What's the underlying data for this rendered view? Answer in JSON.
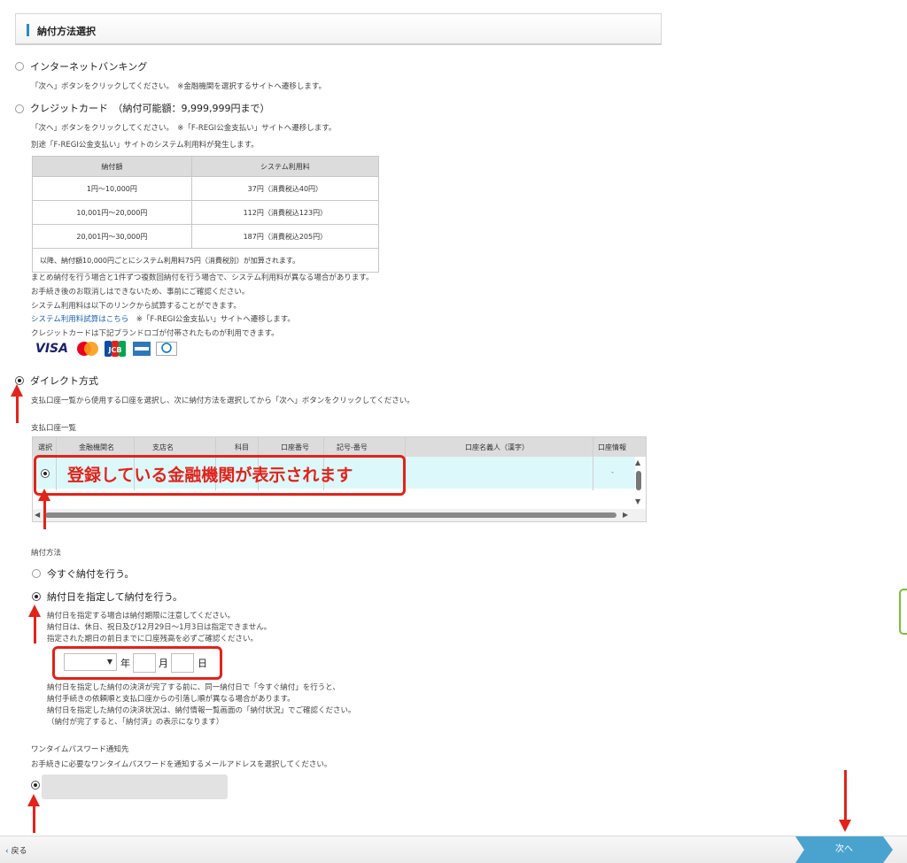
{
  "section": {
    "title": "納付方法選択"
  },
  "methods": {
    "internet_banking": {
      "label": "インターネットバンキング",
      "note": "「次へ」ボタンをクリックしてください。　※金融機関を選択するサイトへ遷移します。"
    },
    "credit_card": {
      "label": "クレジットカード　（納付可能額：9,999,999円まで）",
      "note1": "「次へ」ボタンをクリックしてください。　※「F-REGI公金支払い」サイトへ遷移します。",
      "note2": "別途「F-REGI公金支払い」サイトのシステム利用料が発生します。",
      "fee_table": {
        "headers": [
          "納付額",
          "システム利用料"
        ],
        "rows": [
          [
            "1円～10,000円",
            "37円（消費税込40円）"
          ],
          [
            "10,001円～20,000円",
            "112円（消費税込123円）"
          ],
          [
            "20,001円～30,000円",
            "187円（消費税込205円）"
          ]
        ],
        "footer": "以降、納付額10,000円ごとにシステム利用料75円（消費税別）が加算されます。"
      },
      "after1": "まとめ納付を行う場合と1件ずつ複数回納付を行う場合で、システム利用料が異なる場合があります。",
      "after2": "お手続き後のお取消しはできないため、事前にご確認ください。",
      "after3": "システム利用料は以下のリンクから試算することができます。",
      "link": "システム利用料試算はこちら",
      "link_note": "　※「F-REGI公金支払い」サイトへ遷移します。",
      "brand_note": "クレジットカードは下記ブランドロゴが付帯されたものが利用できます。",
      "brands": [
        "VISA",
        "mastercard",
        "JCB",
        "AMERICAN EXPRESS",
        "Diners Club"
      ]
    },
    "direct": {
      "label": "ダイレクト方式",
      "note": "支払口座一覧から使用する口座を選択し、次に納付方法を選択してから「次へ」ボタンをクリックしてください。"
    }
  },
  "accounts": {
    "title": "支払口座一覧",
    "headers": [
      "選択",
      "金融機関名",
      "支店名",
      "科目",
      "口座番号",
      "記号-番号",
      "口座名義人（漢字）",
      "口座情報"
    ],
    "row": {
      "status": "-"
    },
    "annotation": "登録している金融機関が表示されます"
  },
  "payment_method": {
    "title": "納付方法",
    "now_label": "今すぐ納付を行う。",
    "scheduled_label": "納付日を指定して納付を行う。",
    "notes_before": [
      "納付日を指定する場合は納付期限に注意してください。",
      "納付日は、休日、祝日及び12月29日～1月3日は指定できません。",
      "指定された期日の前日までに口座残高を必ずご確認ください。"
    ],
    "date": {
      "year_unit": "年",
      "month_unit": "月",
      "day_unit": "日"
    },
    "notes_after": [
      "納付日を指定した納付の決済が完了する前に、同一納付日で「今すぐ納付」を行うと、",
      "納付手続きの依頼順と支払口座からの引落し順が異なる場合があります。",
      "納付日を指定した納付の決済状況は、納付情報一覧画面の「納付状況」でご確認ください。",
      "（納付が完了すると、「納付済」の表示になります）"
    ]
  },
  "otp": {
    "title": "ワンタイムパスワード通知先",
    "note": "お手続きに必要なワンタイムパスワードを通知するメールアドレスを選択してください。"
  },
  "footer": {
    "back": "戻る",
    "next": "次へ"
  },
  "colors": {
    "accent": "#2a8ac6",
    "annotation_red": "#e2231a",
    "selected_row": "#ddf8fa",
    "next_button": "#4aa3cf"
  }
}
